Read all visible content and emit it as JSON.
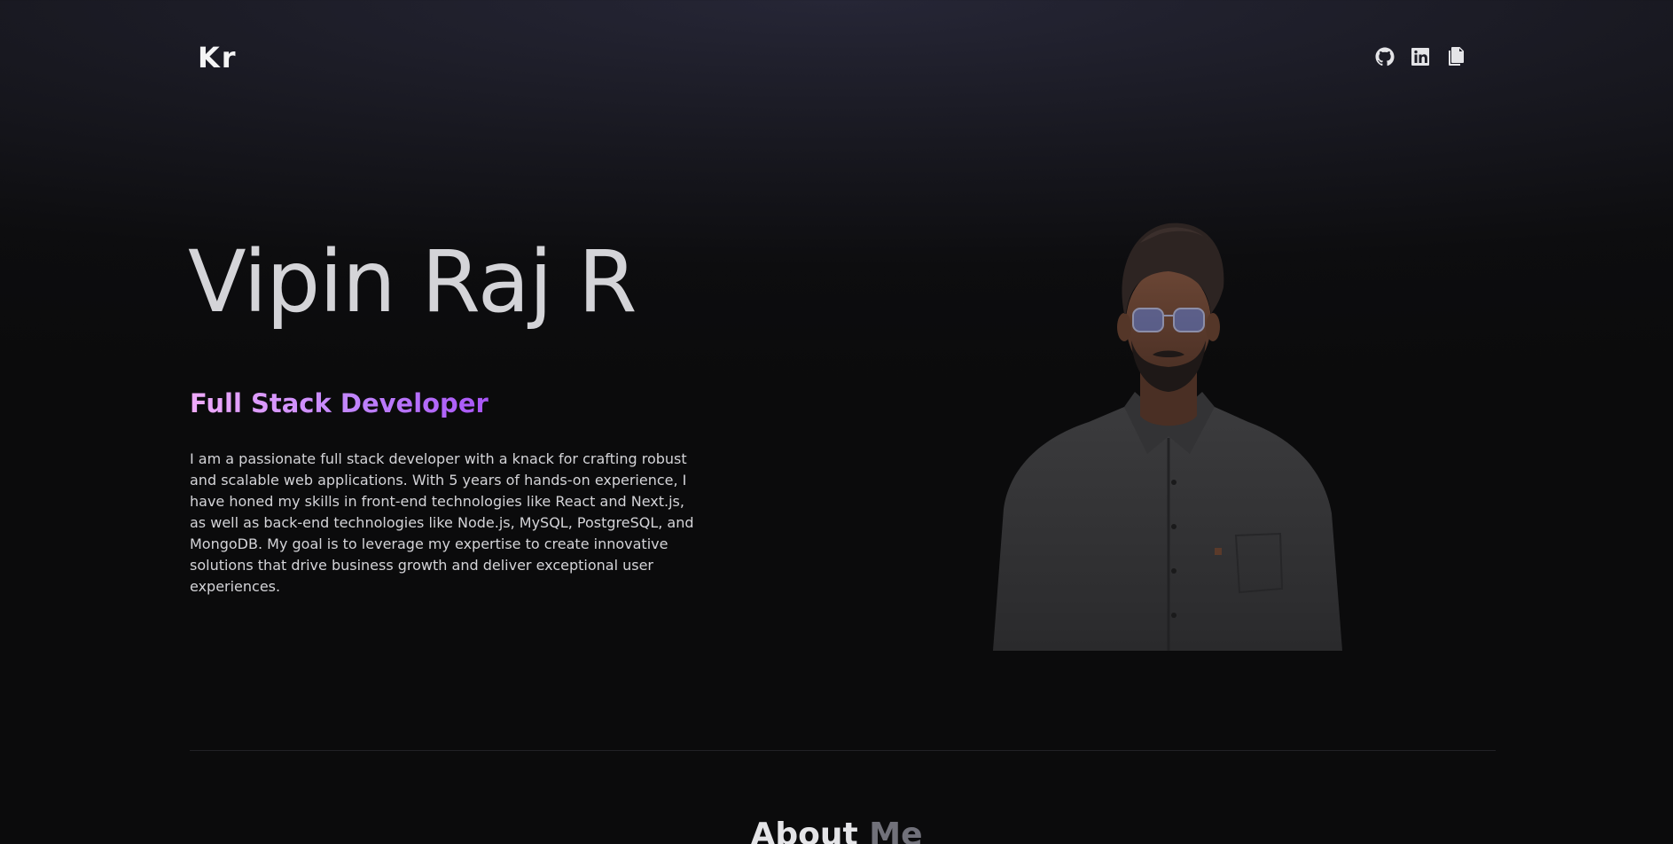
{
  "header": {
    "logo": "Kr",
    "links": [
      {
        "icon": "github-icon",
        "label": "GitHub"
      },
      {
        "icon": "linkedin-icon",
        "label": "LinkedIn"
      },
      {
        "icon": "resume-icon",
        "label": "Resume"
      }
    ]
  },
  "hero": {
    "name": "Vipin Raj R",
    "role": "Full Stack Developer",
    "bio": "I am a passionate full stack developer with a knack for crafting robust and scalable web applications. With 5 years of hands-on experience, I have honed my skills in front-end technologies like React and Next.js, as well as back-end technologies like Node.js, MySQL, PostgreSQL, and MongoDB. My goal is to leverage my expertise to create innovative solutions that drive business growth and deliver exceptional user experiences."
  },
  "about": {
    "title_main": "About",
    "title_accent": "Me"
  },
  "colors": {
    "background": "#0b0b0c",
    "text": "#d4d4d8",
    "gradient_start": "#f0abfc",
    "gradient_end": "#a855f7"
  }
}
